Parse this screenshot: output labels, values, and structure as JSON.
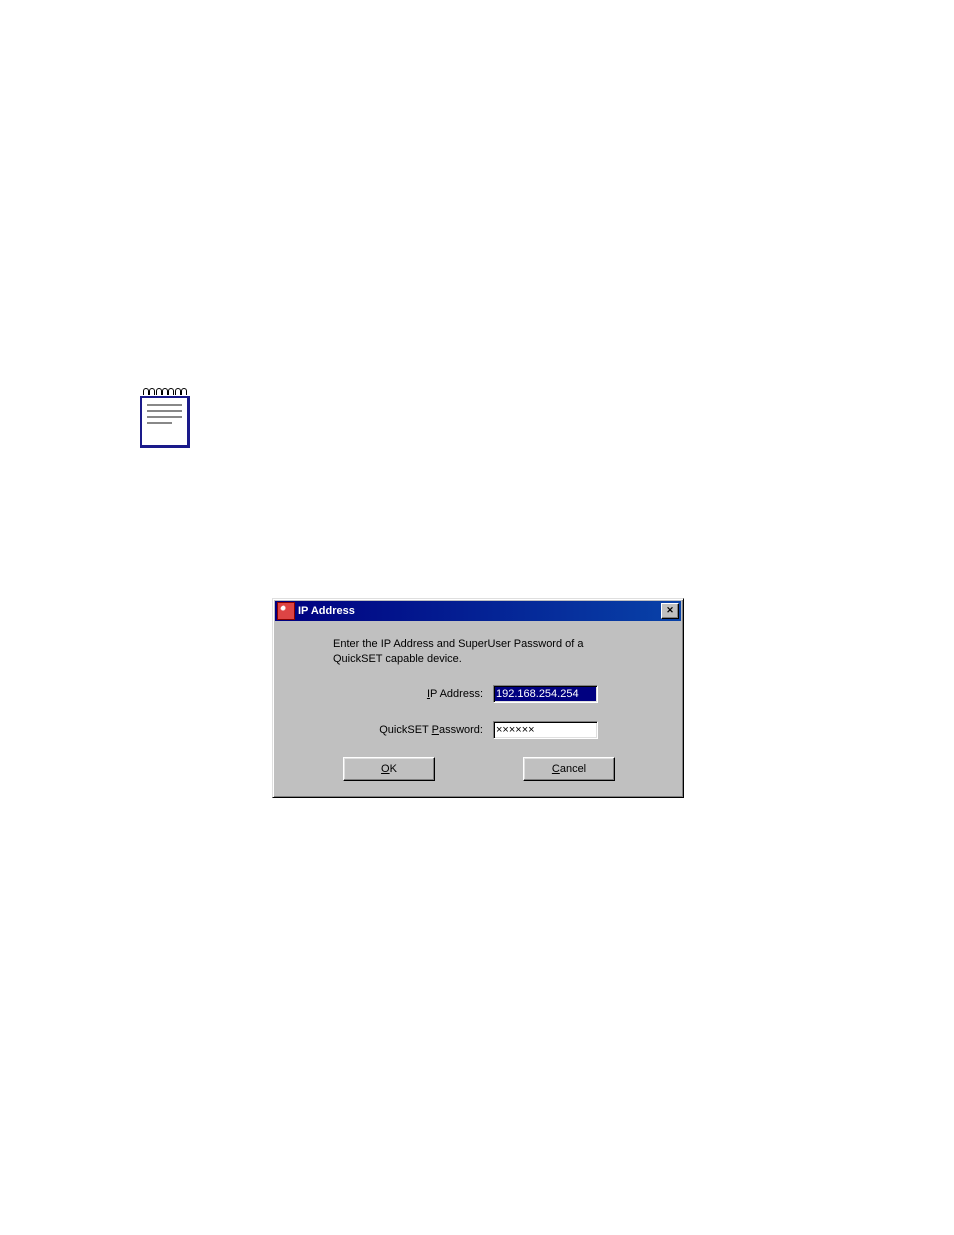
{
  "dialog": {
    "title": "IP Address",
    "instruction": "Enter the IP Address and SuperUser Password of a QuickSET capable device.",
    "ip_label_pre": "I",
    "ip_label_post": "P Address:",
    "ip_value": "192.168.254.254",
    "password_label_pre": "QuickSET ",
    "password_label_u": "P",
    "password_label_post": "assword:",
    "password_value": "××××××",
    "ok_u": "O",
    "ok_post": "K",
    "cancel_u": "C",
    "cancel_post": "ancel"
  }
}
